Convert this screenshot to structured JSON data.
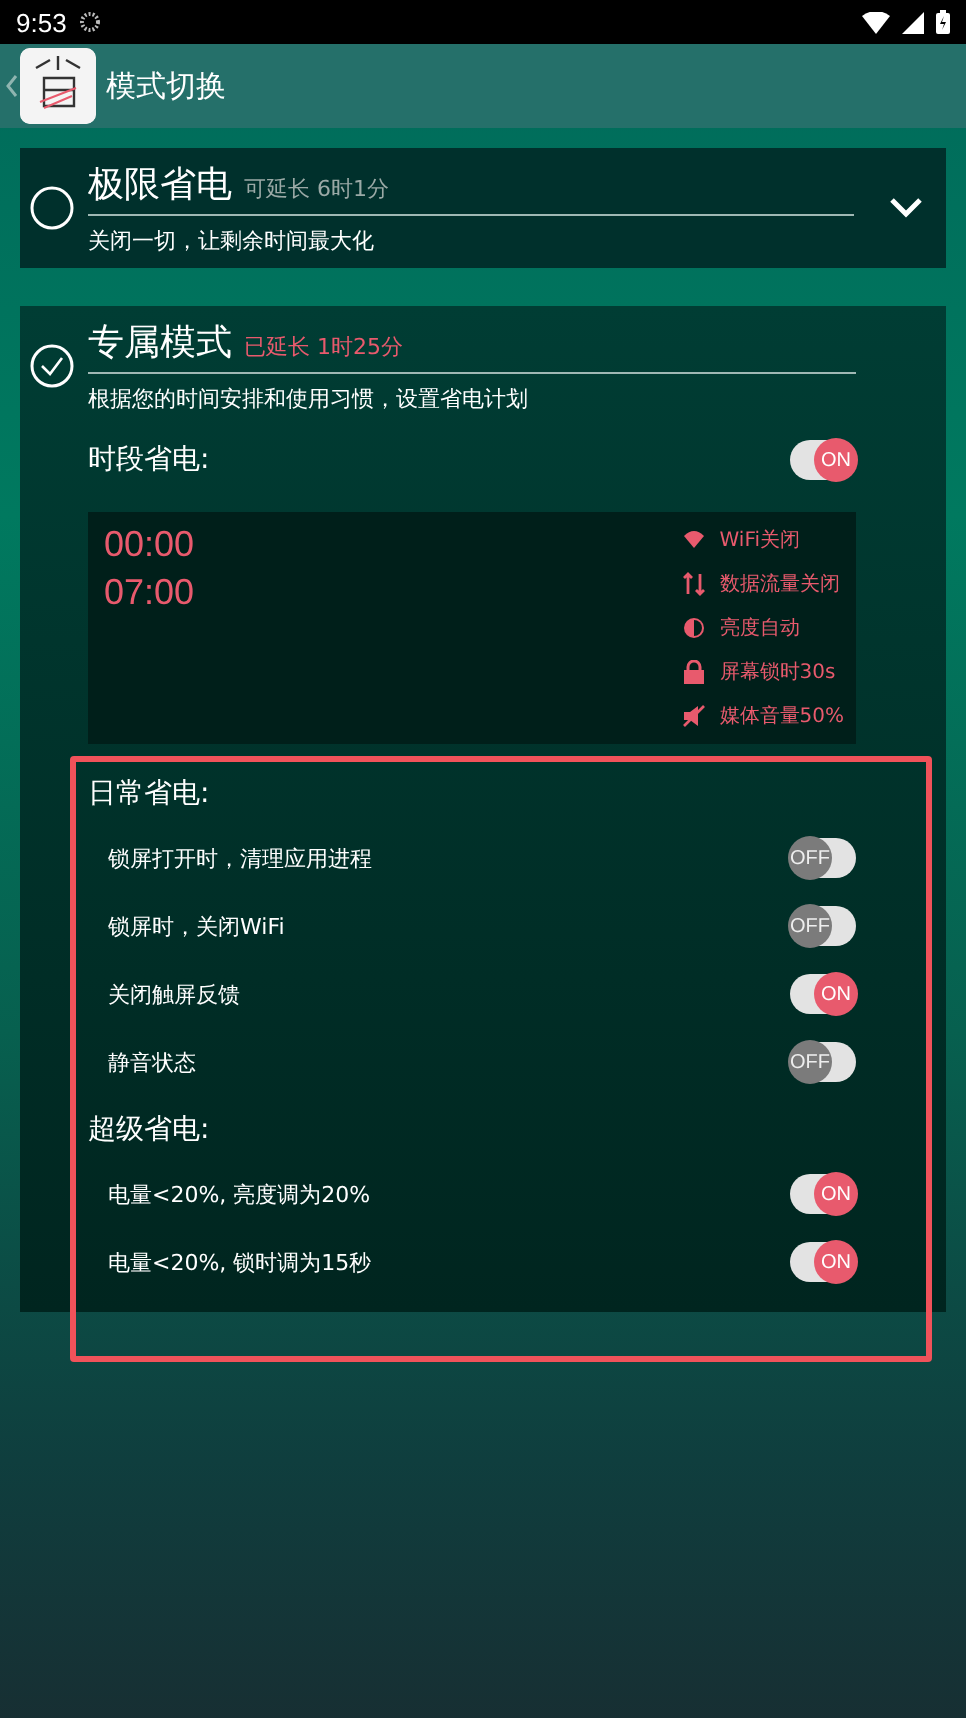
{
  "status_bar": {
    "time": "9:53"
  },
  "app_bar": {
    "title": "模式切换"
  },
  "modes": [
    {
      "kind": "collapsed",
      "title": "极限省电",
      "note": "可延长 6时1分",
      "description": "关闭一切，让剩余时间最大化",
      "selected": false
    },
    {
      "kind": "expanded",
      "title": "专属模式",
      "note": "已延长 1时25分",
      "description": "根据您的时间安排和使用习惯，设置省电计划",
      "selected": true
    }
  ],
  "schedule": {
    "label": "时段省电:",
    "on": true,
    "switch_text": "ON",
    "start": "00:00",
    "end": "07:00",
    "rules": [
      {
        "kind": "wifi",
        "text": "WiFi关闭"
      },
      {
        "kind": "data",
        "text": "数据流量关闭"
      },
      {
        "kind": "brightness",
        "text": "亮度自动"
      },
      {
        "kind": "lock",
        "text": "屏幕锁时30s"
      },
      {
        "kind": "mute",
        "text": "媒体音量50%"
      }
    ]
  },
  "sections": [
    {
      "title": "日常省电:",
      "items": [
        {
          "label": "锁屏打开时，清理应用进程",
          "on": false,
          "switch_text": "OFF"
        },
        {
          "label": "锁屏时，关闭WiFi",
          "on": false,
          "switch_text": "OFF"
        },
        {
          "label": "关闭触屏反馈",
          "on": true,
          "switch_text": "ON"
        },
        {
          "label": "静音状态",
          "on": false,
          "switch_text": "OFF"
        }
      ]
    },
    {
      "title": "超级省电:",
      "items": [
        {
          "label": "电量<20%, 亮度调为20%",
          "on": true,
          "switch_text": "ON"
        },
        {
          "label": "电量<20%, 锁时调为15秒",
          "on": true,
          "switch_text": "ON"
        }
      ]
    }
  ]
}
